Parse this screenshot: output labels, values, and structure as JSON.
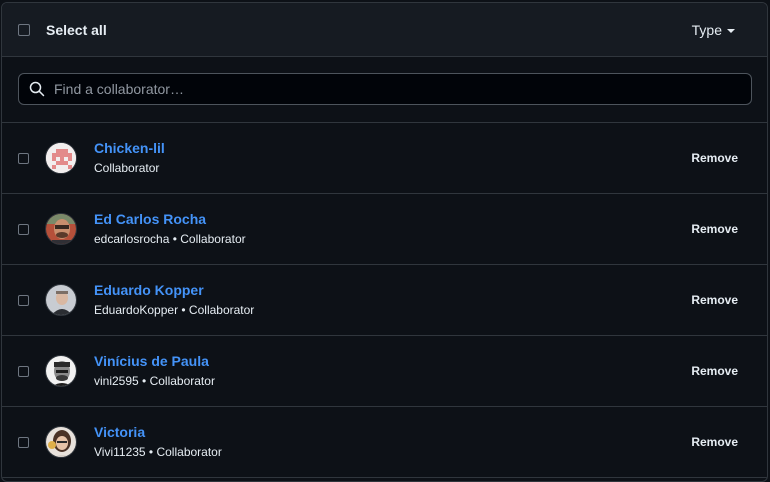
{
  "header": {
    "select_all_label": "Select all",
    "type_label": "Type"
  },
  "search": {
    "placeholder": "Find a collaborator…",
    "value": ""
  },
  "collaborators": [
    {
      "name": "Chicken-lil",
      "subtitle": "Collaborator",
      "avatar": "identicon-avatar"
    },
    {
      "name": "Ed Carlos Rocha",
      "subtitle": "edcarlosrocha • Collaborator",
      "avatar": "photo-avatar"
    },
    {
      "name": "Eduardo Kopper",
      "subtitle": "EduardoKopper • Collaborator",
      "avatar": "photo-avatar"
    },
    {
      "name": "Vinícius de Paula",
      "subtitle": "vini2595 • Collaborator",
      "avatar": "photo-avatar"
    },
    {
      "name": "Victoria",
      "subtitle": "Vivi11235 • Collaborator",
      "avatar": "photo-avatar"
    }
  ],
  "remove_label": "Remove",
  "colors": {
    "background": "#0d1117",
    "header_bg": "#161b22",
    "border": "#30363d",
    "link": "#4493f8",
    "text": "#e6edf3"
  }
}
